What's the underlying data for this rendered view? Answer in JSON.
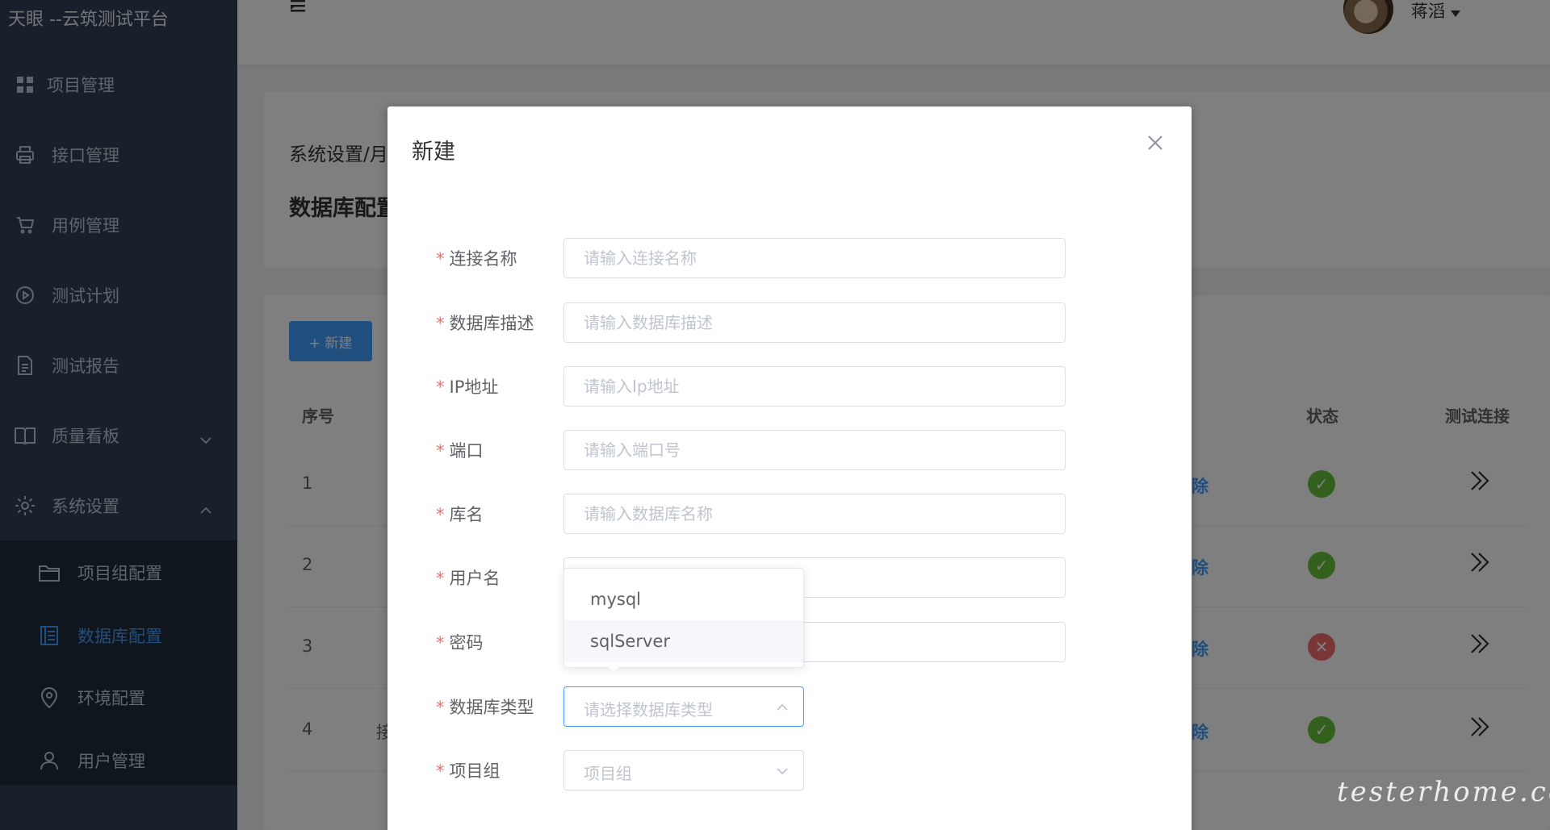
{
  "app": {
    "title": "天眼 --云筑测试平台"
  },
  "sidebar": {
    "items": [
      {
        "label": "项目管理",
        "icon": "grid-icon"
      },
      {
        "label": "接口管理",
        "icon": "printer-icon"
      },
      {
        "label": "用例管理",
        "icon": "cart-icon"
      },
      {
        "label": "测试计划",
        "icon": "play-circle-icon"
      },
      {
        "label": "测试报告",
        "icon": "document-icon"
      },
      {
        "label": "质量看板",
        "icon": "book-icon"
      },
      {
        "label": "系统设置",
        "icon": "gear-icon"
      }
    ],
    "subitems": [
      {
        "label": "项目组配置",
        "icon": "folder-icon"
      },
      {
        "label": "数据库配置",
        "icon": "list-icon",
        "active": true
      },
      {
        "label": "环境配置",
        "icon": "location-icon"
      },
      {
        "label": "用户管理",
        "icon": "user-icon"
      }
    ]
  },
  "header": {
    "username": "蒋滔"
  },
  "page": {
    "breadcrumb": "系统设置/月",
    "title": "数据库配置",
    "new_button": "+ 新建",
    "columns": {
      "index": "序号",
      "status": "状态",
      "test": "测试连接"
    },
    "rows": [
      {
        "index": "1",
        "action": "除",
        "status": "ok"
      },
      {
        "index": "2",
        "action": "除",
        "status": "ok"
      },
      {
        "index": "3",
        "action": "除",
        "status": "error"
      },
      {
        "index": "4",
        "action": "除",
        "status": "ok",
        "text": "接"
      }
    ]
  },
  "dialog": {
    "title": "新建",
    "required_mark": "*",
    "fields": {
      "conn_name": {
        "label": "连接名称",
        "placeholder": "请输入连接名称"
      },
      "db_desc": {
        "label": "数据库描述",
        "placeholder": "请输入数据库描述"
      },
      "ip": {
        "label": "IP地址",
        "placeholder": "请输入Ip地址"
      },
      "port": {
        "label": "端口",
        "placeholder": "请输入端口号"
      },
      "db_name": {
        "label": "库名",
        "placeholder": "请输入数据库名称"
      },
      "username": {
        "label": "用户名",
        "placeholder": ""
      },
      "password": {
        "label": "密码",
        "placeholder": ""
      },
      "db_type": {
        "label": "数据库类型",
        "placeholder": "请选择数据库类型"
      },
      "project_group": {
        "label": "项目组",
        "placeholder": "项目组"
      }
    },
    "db_type_options": [
      "mysql",
      "sqlServer"
    ]
  },
  "watermark": "testerhome.com",
  "colors": {
    "primary": "#409eff",
    "sidebar": "#304156",
    "success": "#67c23a",
    "danger": "#f56c6c"
  }
}
